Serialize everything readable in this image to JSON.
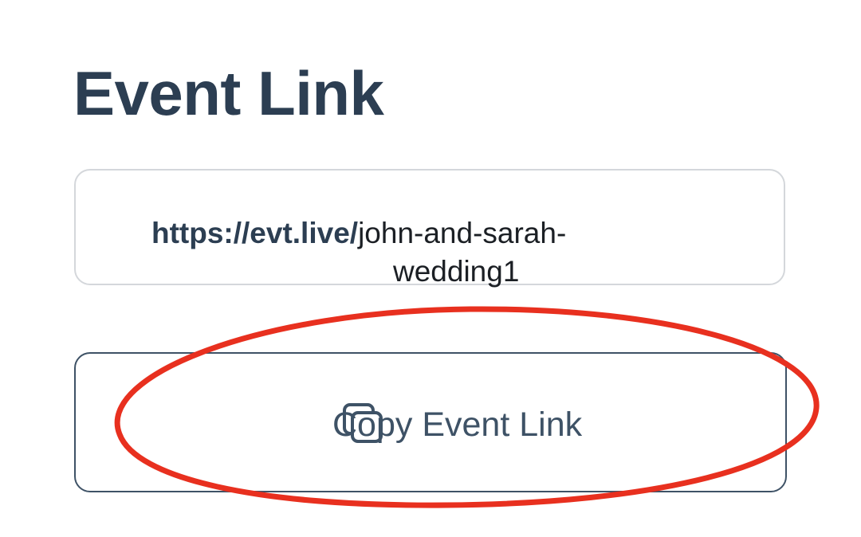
{
  "page": {
    "title": "Event Link"
  },
  "event_link": {
    "domain": "https://evt.live/",
    "slug_part1": "john-and-sarah-",
    "slug_part2": "wedding1"
  },
  "copy_button": {
    "label": "Copy Event Link",
    "icon": "copy-icon"
  },
  "annotation": {
    "shape": "ellipse",
    "color": "#e8301f"
  },
  "colors": {
    "title": "#2c3e52",
    "button_border": "#3e5266",
    "field_border": "#d4d7db"
  }
}
